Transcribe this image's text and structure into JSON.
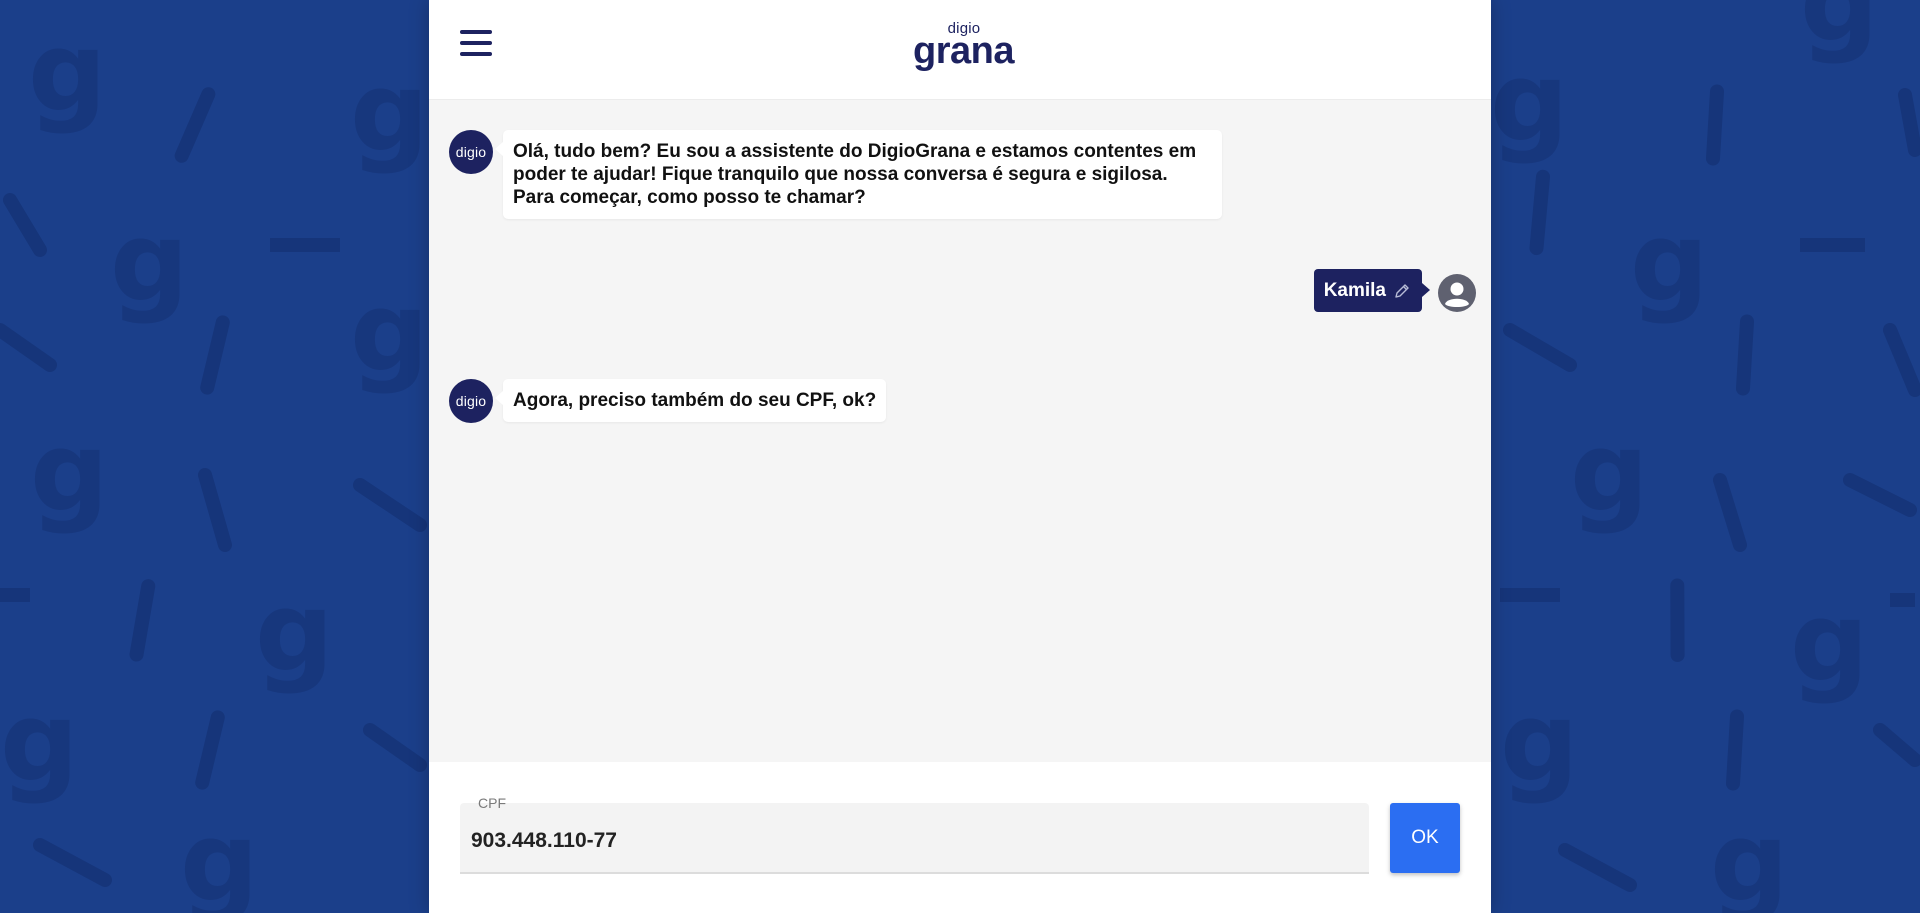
{
  "brand": {
    "small": "digio",
    "big": "grana"
  },
  "colors": {
    "background": "#1b3f8a",
    "navy": "#1d2260",
    "accent": "#2b6ef2",
    "panel": "#f5f5f5"
  },
  "bot_avatar_label": "digio",
  "messages": [
    {
      "from": "bot",
      "text": "Olá, tudo bem? Eu sou a assistente do DigioGrana e estamos contentes em poder te ajudar! Fique tranquilo que nossa conversa é segura e sigilosa. Para começar, como posso te chamar?"
    },
    {
      "from": "user",
      "text": "Kamila"
    },
    {
      "from": "bot",
      "text": "Agora, preciso também do seu CPF, ok?"
    }
  ],
  "input": {
    "label": "CPF",
    "value": "903.448.110-77"
  },
  "submit_label": "OK",
  "icons": [
    "menu-icon",
    "edit-pencil-icon",
    "user-avatar-icon"
  ]
}
